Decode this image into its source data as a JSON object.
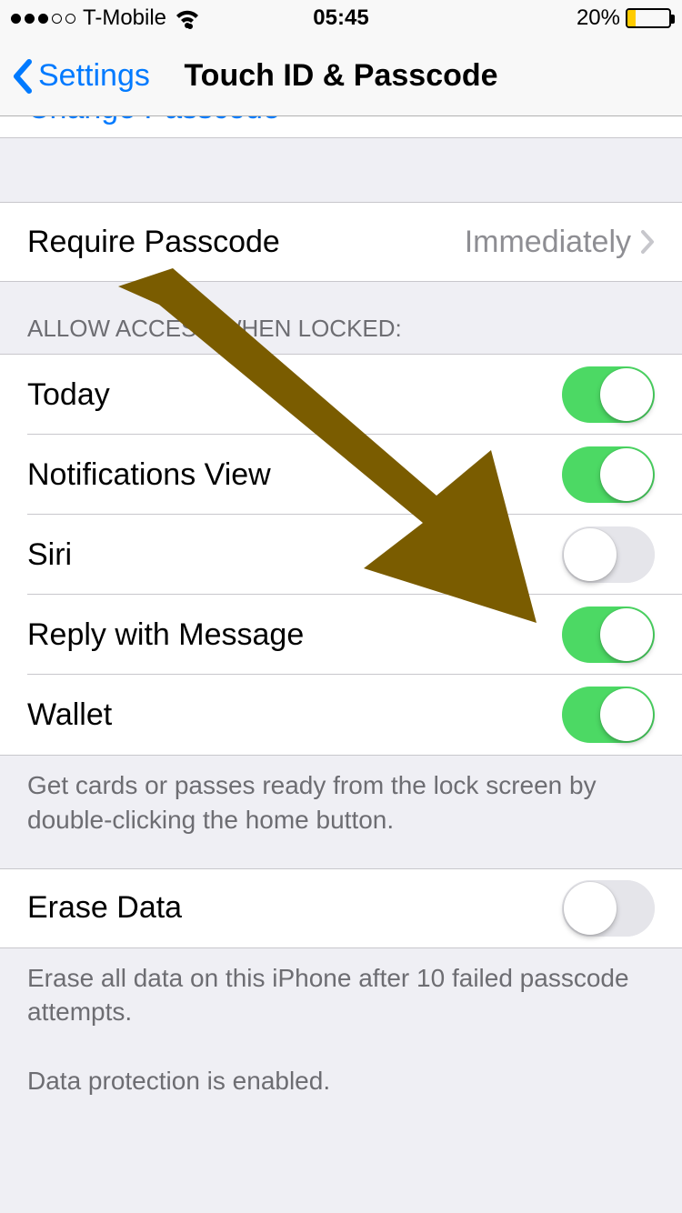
{
  "status": {
    "carrier": "T-Mobile",
    "time": "05:45",
    "battery_pct": "20%"
  },
  "nav": {
    "back_label": "Settings",
    "title": "Touch ID & Passcode"
  },
  "cutoff": {
    "link": "Change Passcode"
  },
  "require": {
    "label": "Require Passcode",
    "value": "Immediately"
  },
  "allow": {
    "header": "Allow access when locked:",
    "items": [
      {
        "label": "Today",
        "on": true
      },
      {
        "label": "Notifications View",
        "on": true
      },
      {
        "label": "Siri",
        "on": false
      },
      {
        "label": "Reply with Message",
        "on": true
      },
      {
        "label": "Wallet",
        "on": true
      }
    ],
    "footer": "Get cards or passes ready from the lock screen by double-clicking the home button."
  },
  "erase": {
    "label": "Erase Data",
    "on": false,
    "footer1": "Erase all data on this iPhone after 10 failed passcode attempts.",
    "footer2": "Data protection is enabled."
  },
  "colors": {
    "accent": "#007AFF",
    "switch_on": "#4CD964",
    "battery_low": "#FFCC00",
    "arrow": "#7A5C00"
  }
}
